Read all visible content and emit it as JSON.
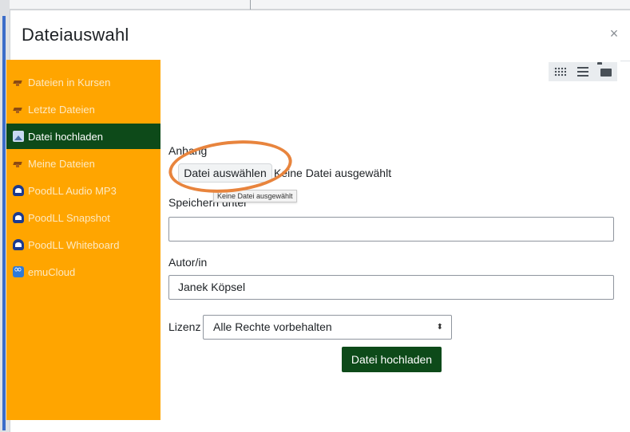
{
  "dialog": {
    "title": "Dateiauswahl",
    "close_glyph": "×"
  },
  "sidebar": {
    "items": [
      {
        "label": "Dateien in Kursen",
        "icon": "hat-icon",
        "active": false
      },
      {
        "label": "Letzte Dateien",
        "icon": "hat-icon",
        "active": false
      },
      {
        "label": "Datei hochladen",
        "icon": "upload-icon",
        "active": true
      },
      {
        "label": "Meine Dateien",
        "icon": "hat-icon",
        "active": false
      },
      {
        "label": "PoodLL Audio MP3",
        "icon": "poodll-icon",
        "active": false
      },
      {
        "label": "PoodLL Snapshot",
        "icon": "poodll-icon",
        "active": false
      },
      {
        "label": "PoodLL Whiteboard",
        "icon": "poodll-icon",
        "active": false
      },
      {
        "label": "emuCloud",
        "icon": "cloud-icon",
        "active": false
      }
    ],
    "color": "#ffa500",
    "active_color": "#0d4a19"
  },
  "toolbar": {
    "views": [
      "grid-icon",
      "list-icon",
      "folder-icon"
    ]
  },
  "form": {
    "attachment_label": "Anhang",
    "choose_file_label": "Datei auswählen",
    "no_file_text": "Keine Datei ausgewählt",
    "tooltip_text": "Keine Datei ausgewählt",
    "save_as_label": "Speichern unter",
    "save_as_value": "",
    "author_label": "Autor/in",
    "author_value": "Janek Köpsel",
    "license_label": "Lizenz",
    "license_value": "Alle Rechte vorbehalten",
    "license_arrows": "⬍",
    "submit_label": "Datei hochladen"
  },
  "annotation": {
    "color": "#e8843d"
  }
}
